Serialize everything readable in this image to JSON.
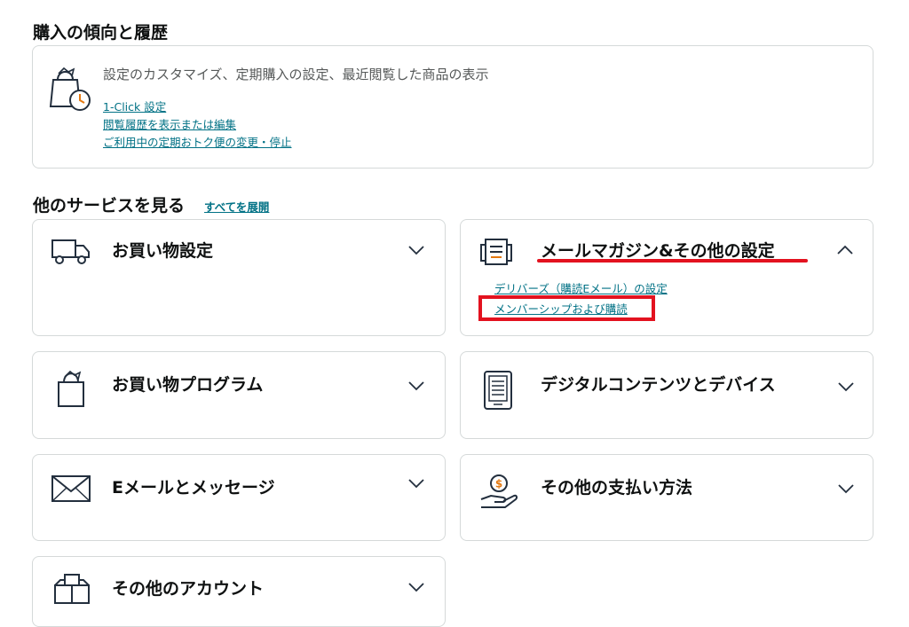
{
  "history": {
    "title": "購入の傾向と履歴",
    "description": "設定のカスタマイズ、定期購入の設定、最近閲覧した商品の表示",
    "links": [
      "1-Click 設定",
      "閲覧履歴を表示または編集",
      "ご利用中の定期おトク便の変更・停止"
    ],
    "icon": "shopping-bag-clock-icon"
  },
  "services": {
    "title": "他のサービスを見る",
    "expand_all": "すべてを展開",
    "cards": [
      {
        "title": "お買い物設定",
        "icon": "truck-icon",
        "expanded": false
      },
      {
        "title": "メールマガジン&その他の設定",
        "icon": "newsletter-icon",
        "expanded": true,
        "links": [
          "デリバーズ（購読Eメール）の設定",
          "メンバーシップおよび購読"
        ]
      },
      {
        "title": "お買い物プログラム",
        "icon": "shopping-bag-icon",
        "expanded": false
      },
      {
        "title": "デジタルコンテンツとデバイス",
        "icon": "ereader-icon",
        "expanded": false
      },
      {
        "title": "Eメールとメッセージ",
        "icon": "envelope-icon",
        "expanded": false
      },
      {
        "title": "その他の支払い方法",
        "icon": "coin-hand-icon",
        "expanded": false
      },
      {
        "title": "その他のアカウント",
        "icon": "boxes-icon",
        "expanded": false
      }
    ]
  },
  "annotations": {
    "color": "#e3121f"
  }
}
